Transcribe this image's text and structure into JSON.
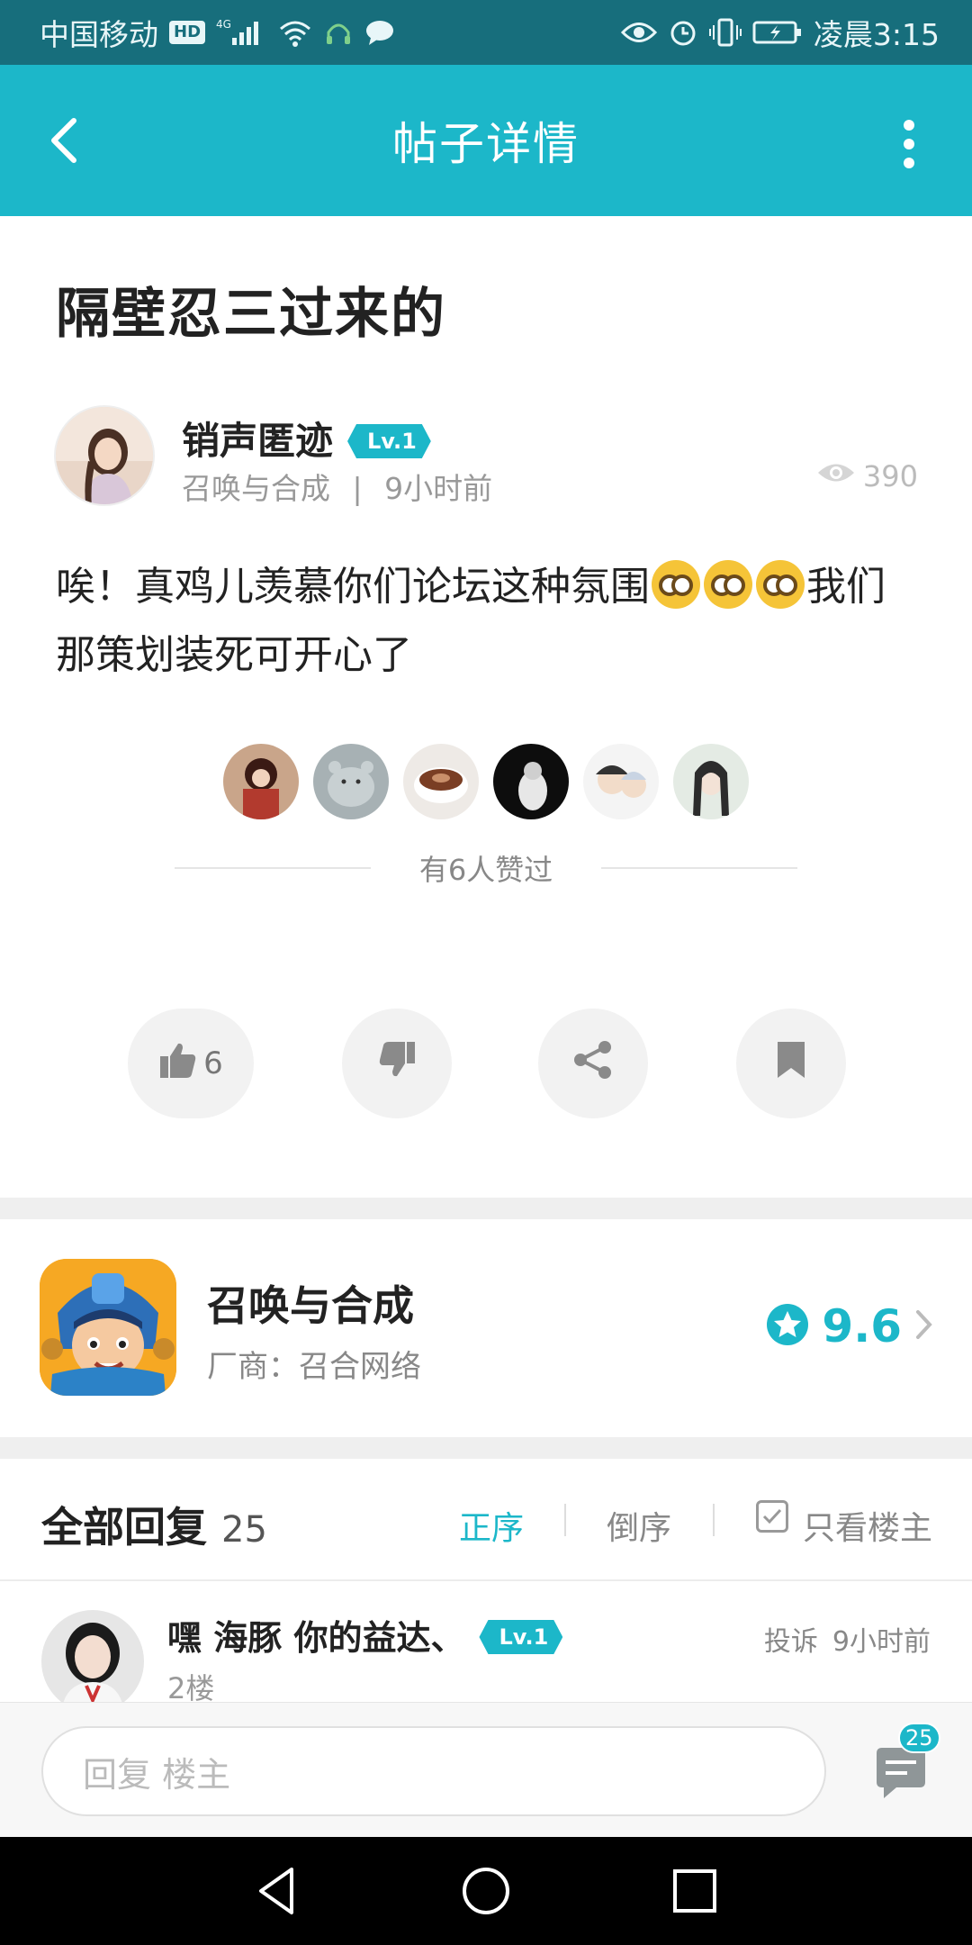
{
  "status_bar": {
    "carrier": "中国移动",
    "hd": "HD",
    "network": "4G",
    "time": "凌晨3:15"
  },
  "app_bar": {
    "title": "帖子详情"
  },
  "post": {
    "title": "隔壁忍三过来的",
    "author": {
      "name": "销声匿迹",
      "level": "Lv.1",
      "game": "召唤与合成",
      "separator": "|",
      "time": "9小时前"
    },
    "views": "390",
    "body_part1": "唉！真鸡儿羡慕你们论坛这种氛围",
    "body_part2": "我们那策划装死可开心了",
    "liked_text": "有6人赞过",
    "likes_count": "6"
  },
  "game_card": {
    "name": "召唤与合成",
    "vendor": "厂商：召合网络",
    "rating": "9.6"
  },
  "replies": {
    "title": "全部回复",
    "count": "25",
    "sort_asc": "正序",
    "sort_desc": "倒序",
    "only_op": "只看楼主",
    "items": [
      {
        "name": "嘿 海豚 你的益达、",
        "level": "Lv.1",
        "floor": "2楼",
        "report": "投诉",
        "time": "9小时前"
      }
    ]
  },
  "reply_bar": {
    "placeholder": "回复 楼主",
    "comment_count": "25"
  },
  "colors": {
    "accent": "#1cb7c9",
    "status_bar": "#176e7c"
  }
}
